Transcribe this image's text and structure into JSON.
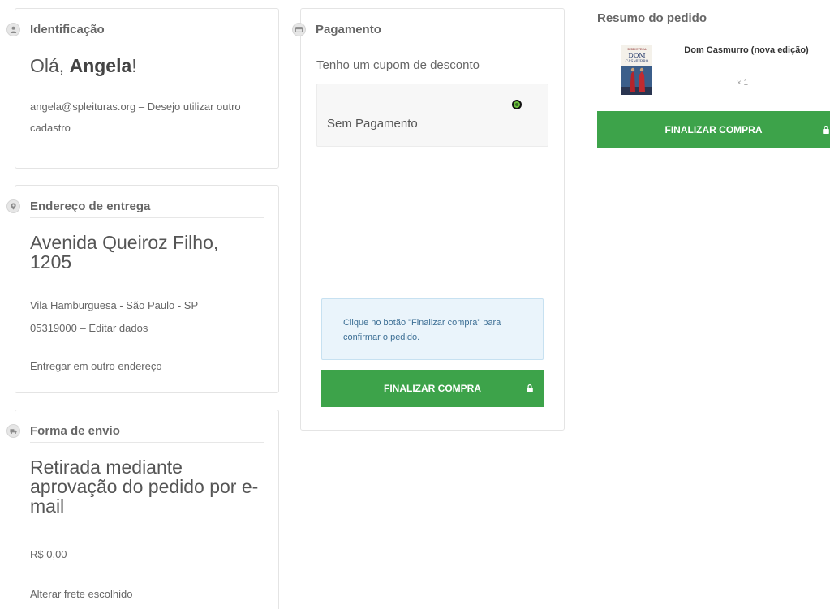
{
  "identification": {
    "title": "Identificação",
    "greeting_prefix": "Olá,",
    "name": "Angela",
    "greeting_suffix": "!",
    "email": "angela@spleituras.org",
    "separator": "–",
    "other_account_link": "Desejo utilizar outro cadastro"
  },
  "address": {
    "title": "Endereço de entrega",
    "street": "Avenida Queiroz Filho, 1205",
    "district_city": "Vila Hamburguesa - São Paulo - SP",
    "zip": "05319000",
    "separator": "–",
    "edit_link": "Editar dados",
    "other_address_link": "Entregar em outro endereço"
  },
  "shipping": {
    "title": "Forma de envio",
    "method": "Retirada mediante aprovação do pedido por e-mail",
    "price": "R$ 0,00",
    "change_link": "Alterar frete escolhido"
  },
  "payment": {
    "title": "Pagamento",
    "coupon_link": "Tenho um cupom de desconto",
    "option_label": "Sem Pagamento",
    "info_text": "Clique no botão \"Finalizar compra\" para confirmar o pedido.",
    "finalize_label": "FINALIZAR COMPRA"
  },
  "summary": {
    "title": "Resumo do pedido",
    "product_name": "Dom Casmurro (nova edição)",
    "quantity": "× 1",
    "finalize_label": "FINALIZAR COMPRA"
  },
  "colors": {
    "button_green": "#3da34a",
    "info_bg": "#eaf4fb",
    "info_text": "#3d6f95"
  },
  "icons": {
    "identification": "user-icon",
    "address": "map-pin-icon",
    "shipping": "truck-icon",
    "payment": "credit-card-icon",
    "button": "lock-icon"
  }
}
